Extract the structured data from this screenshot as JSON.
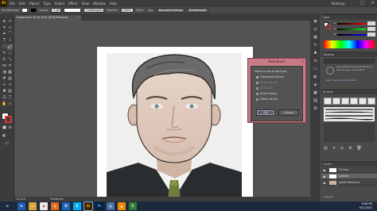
{
  "app": {
    "logo": "Ai",
    "menu": [
      "File",
      "Edit",
      "Object",
      "Type",
      "Select",
      "Effect",
      "View",
      "Window",
      "Help"
    ],
    "workspace": "Painting",
    "window_controls": [
      "minimize",
      "maximize",
      "close"
    ]
  },
  "controlbar": {
    "no_selection": "No Selection",
    "stroke_label": "Stroke:",
    "stroke_value": "1 pt",
    "brush_name": "Calligraphic",
    "opacity_label": "Opacity:",
    "opacity_value": "100%",
    "style_label": "Style:",
    "doc_setup": "Document Setup",
    "preferences": "Preferences"
  },
  "document": {
    "tab_title": "PosterLeo1 @ 44.42% (RGB/Preview)",
    "close": "×"
  },
  "status": {
    "zoom": "44.42%",
    "tool": "Paintbrush"
  },
  "dialog": {
    "title": "New Brush",
    "close": "×",
    "prompt": "Select a new brush type:",
    "options": [
      {
        "label": "Calligraphic Brush",
        "selected": true,
        "enabled": true
      },
      {
        "label": "Scatter Brush",
        "selected": false,
        "enabled": false
      },
      {
        "label": "Art Brush",
        "selected": false,
        "enabled": false
      },
      {
        "label": "Bristle Brush",
        "selected": false,
        "enabled": true
      },
      {
        "label": "Pattern Brush",
        "selected": false,
        "enabled": true
      }
    ],
    "ok": "OK",
    "cancel": "Cancel"
  },
  "panels": {
    "color": {
      "title": "Color",
      "r_label": "R",
      "g_label": "G",
      "b_label": "B"
    },
    "libraries": {
      "title": "Libraries",
      "message": "Drag artwork into your library to use it in your documents",
      "link": "Learn more about Libraries"
    },
    "brushes": {
      "title": "Brushes"
    },
    "layers": {
      "title": "Layers",
      "rows": [
        {
          "name": "Fill lines",
          "selected": false
        },
        {
          "name": "outlines",
          "selected": true
        },
        {
          "name": "photo Reference",
          "selected": false
        }
      ],
      "count": "3 Layers"
    }
  },
  "taskbar": {
    "apps": [
      "start",
      "ie",
      "explorer",
      "chrome",
      "firefox",
      "outlook",
      "skype",
      "illustrator",
      "photoshop",
      "files",
      "vlc",
      "camtasia"
    ],
    "time": "6:08 PM",
    "date": "9/11/2015"
  }
}
